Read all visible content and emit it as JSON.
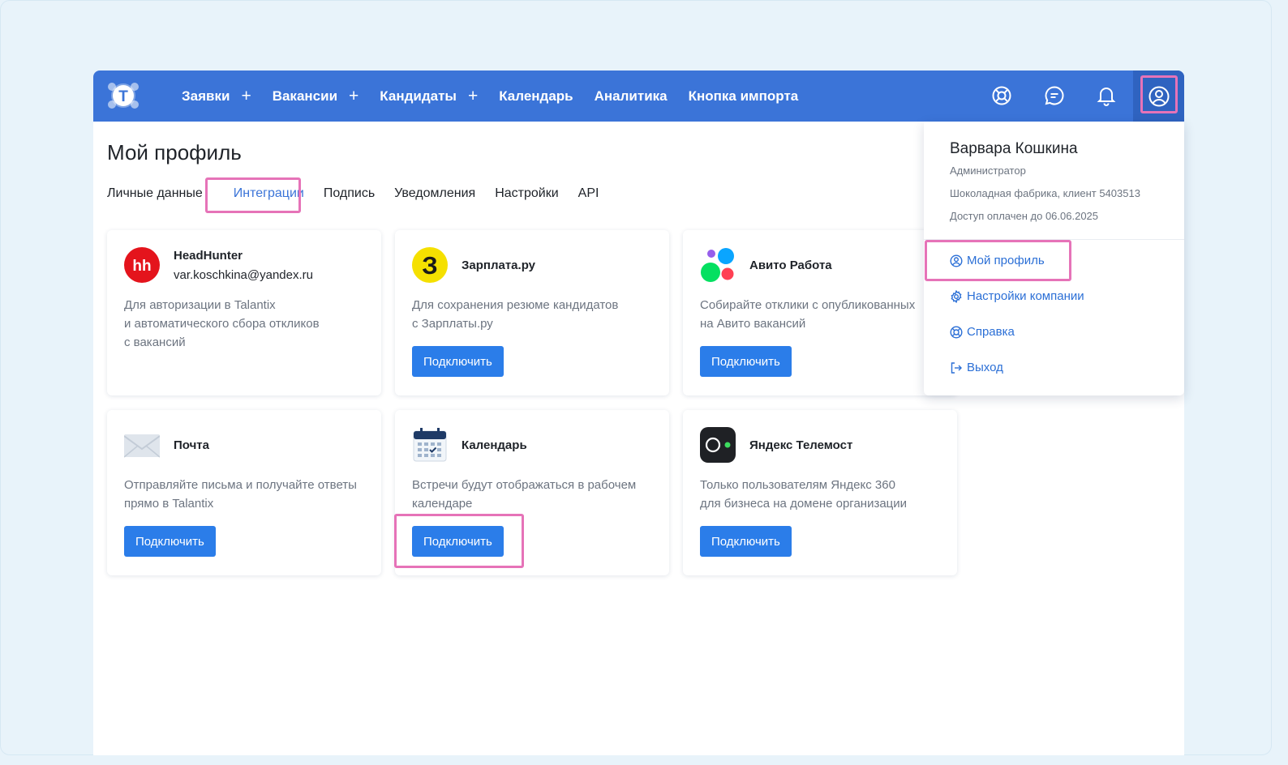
{
  "nav": {
    "items": [
      {
        "label": "Заявки",
        "plus": "+"
      },
      {
        "label": "Вакансии",
        "plus": "+"
      },
      {
        "label": "Кандидаты",
        "plus": "+"
      },
      {
        "label": "Календарь",
        "plus": ""
      },
      {
        "label": "Аналитика",
        "plus": ""
      },
      {
        "label": "Кнопка импорта",
        "plus": ""
      }
    ],
    "logo_letter": "T"
  },
  "page": {
    "title": "Мой профиль",
    "tabs": [
      "Личные данные",
      "Интеграции",
      "Подпись",
      "Уведомления",
      "Настройки",
      "API"
    ],
    "active_tab": "Интеграции"
  },
  "integrations": [
    {
      "title": "HeadHunter",
      "sub": "var.koschkina@yandex.ru",
      "desc": "Для авторизации в Talantix\nи автоматического сбора откликов\nс вакансий",
      "button": "",
      "icon": "headhunter-logo",
      "icon_text": "hh"
    },
    {
      "title": "Зарплата.ру",
      "sub": "",
      "desc": "Для сохранения резюме кандидатов\nс Зарплаты.ру",
      "button": "Подключить",
      "icon": "zarplata-logo",
      "icon_text": "З"
    },
    {
      "title": "Авито Работа",
      "sub": "",
      "desc": "Собирайте отклики с опубликованных\nна Авито вакансий",
      "button": "Подключить",
      "icon": "avito-logo",
      "icon_text": ""
    },
    {
      "title": "Почта",
      "sub": "",
      "desc": "Отправляйте письма и получайте ответы\nпрямо в Talantix",
      "button": "Подключить",
      "icon": "mail-icon",
      "icon_text": ""
    },
    {
      "title": "Календарь",
      "sub": "",
      "desc": "Встречи будут отображаться в рабочем\nкалендаре",
      "button": "Подключить",
      "icon": "calendar-icon",
      "icon_text": ""
    },
    {
      "title": "Яндекс Телемост",
      "sub": "",
      "desc": "Только пользователям Яндекс 360\nдля бизнеса на домене организации",
      "button": "Подключить",
      "icon": "telemost-logo",
      "icon_text": ""
    }
  ],
  "profile_menu": {
    "name": "Варвара Кошкина",
    "role": "Администратор",
    "company": "Шоколадная фабрика, клиент 5403513",
    "access": "Доступ оплачен до 06.06.2025",
    "items": [
      {
        "label": "Мой профиль",
        "icon": "user-circle-icon"
      },
      {
        "label": "Настройки компании",
        "icon": "gear-icon"
      },
      {
        "label": "Справка",
        "icon": "lifebuoy-icon"
      },
      {
        "label": "Выход",
        "icon": "logout-icon"
      }
    ]
  },
  "colors": {
    "topbar": "#3b74d8",
    "accent": "#2b7de9",
    "highlight": "#e673b8",
    "link": "#2b6fd6"
  }
}
